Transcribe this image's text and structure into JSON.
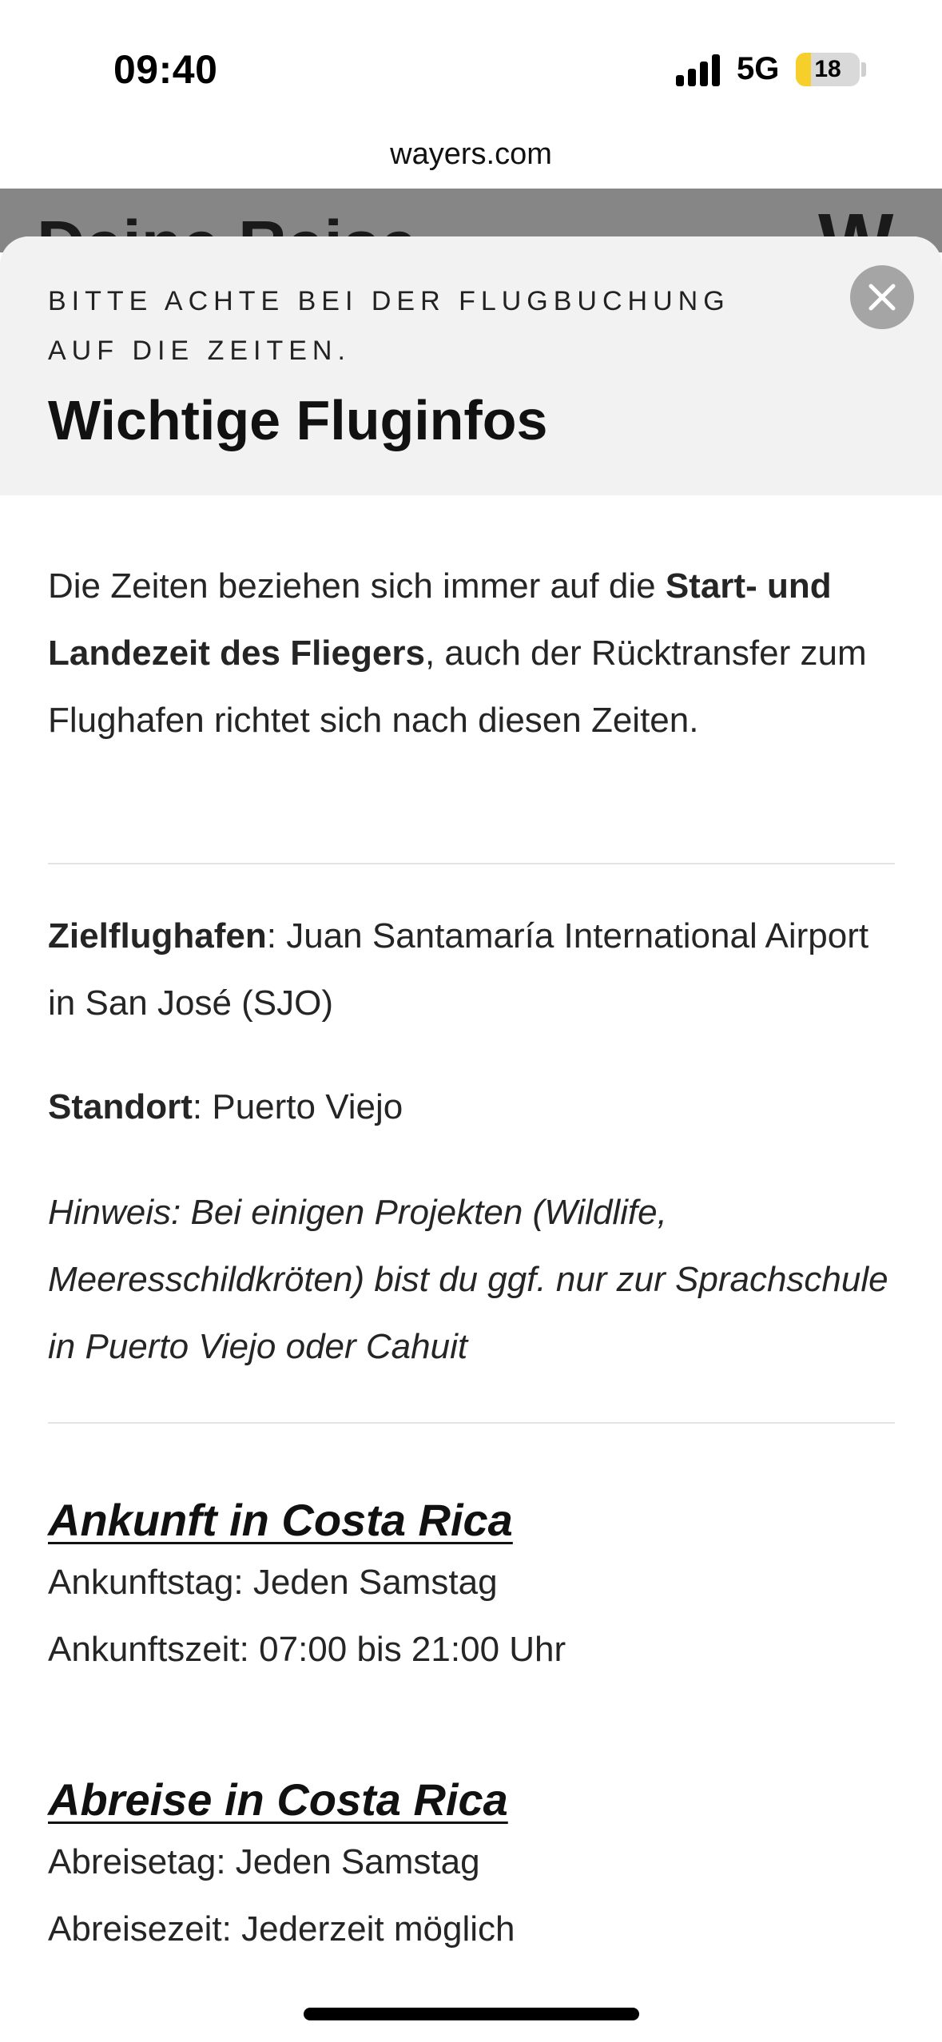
{
  "status_bar": {
    "time": "09:40",
    "network": "5G",
    "battery": "18",
    "battery_fraction": 0.18,
    "url": "wayers.com"
  },
  "background_page": {
    "title": "Deine Reise",
    "logo": "W"
  },
  "modal": {
    "kicker": "BITTE ACHTE BEI DER FLUGBUCHUNG AUF DIE ZEITEN.",
    "title": "Wichtige Fluginfos",
    "close_icon": "close-icon",
    "intro": {
      "part1": "Die Zeiten beziehen sich immer auf die ",
      "bold": "Start- und Landezeit des Fliegers",
      "part2": ", auch der Rücktransfer zum Flughafen richtet sich nach diesen Zeiten."
    },
    "destination": {
      "label": "Zielflughafen",
      "value": ": Juan Santamaría International Airport in San José (SJO)"
    },
    "location": {
      "label": "Standort",
      "value": ": Puerto Viejo"
    },
    "note": "Hinweis: Bei einigen Projekten (Wildlife, Meeresschildkröten) bist du ggf. nur zur Sprachschule in Puerto Viejo oder Cahuit",
    "arrival": {
      "title": "Ankunft in Costa Rica",
      "day": "Ankunftstag: Jeden Samstag",
      "time": "Ankunftszeit: 07:00 bis 21:00 Uhr"
    },
    "departure": {
      "title": "Abreise in Costa Rica",
      "day": "Abreisetag: Jeden Samstag",
      "time": "Abreisezeit: Jederzeit möglich"
    }
  },
  "colors": {
    "header_bg": "#f1f2f1",
    "close_bg": "#a5a5a5",
    "battery_fill": "#f7cf2b"
  }
}
